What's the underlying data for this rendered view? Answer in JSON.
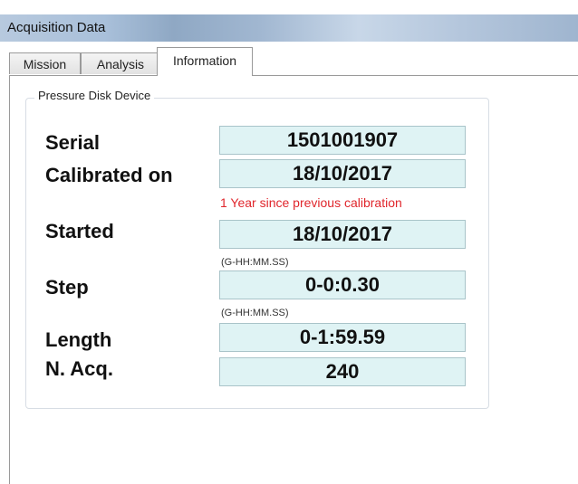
{
  "window": {
    "title": "Acquisition Data"
  },
  "tabs": [
    {
      "label": "Mission"
    },
    {
      "label": "Analysis"
    },
    {
      "label": "Information"
    }
  ],
  "group": {
    "label": "Pressure Disk Device"
  },
  "fields": {
    "serial": {
      "label": "Serial",
      "value": "1501001907"
    },
    "calibrated_on": {
      "label": "Calibrated on",
      "value": "18/10/2017",
      "note": "1 Year since previous calibration"
    },
    "started": {
      "label": "Started",
      "value": "18/10/2017"
    },
    "step": {
      "label": "Step",
      "hint": "(G-HH:MM.SS)",
      "value": "0-0:0.30"
    },
    "length": {
      "label": "Length",
      "hint": "(G-HH:MM.SS)",
      "value": "0-1:59.59"
    },
    "n_acq": {
      "label": "N. Acq.",
      "value": "240"
    }
  },
  "colors": {
    "value_background": "#dff3f4",
    "note_red": "#e0262c"
  }
}
